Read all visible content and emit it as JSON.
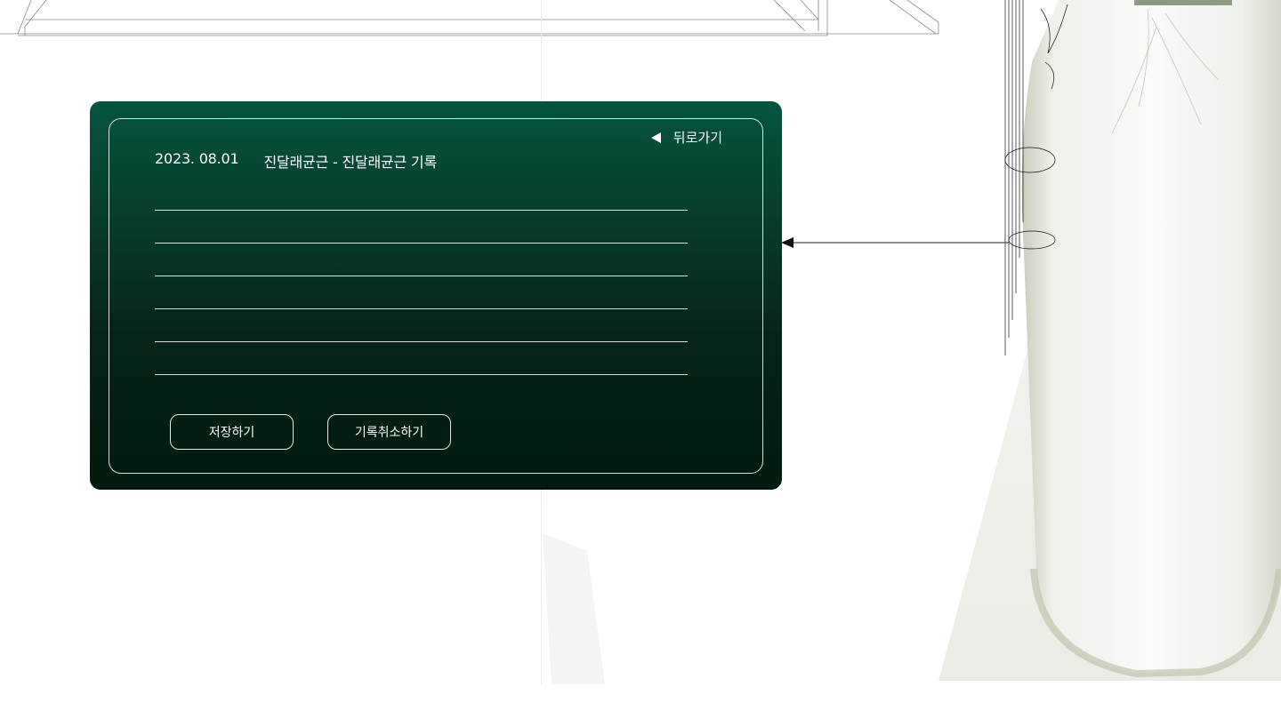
{
  "card": {
    "back_label": "뒤로가기",
    "date": "2023. 08.01",
    "subject": "진달래균근 - 진달래균근 기록",
    "entry_lines": [
      "",
      "",
      "",
      "",
      "",
      ""
    ],
    "buttons": {
      "save_label": "저장하기",
      "cancel_label": "기록취소하기"
    }
  },
  "colors": {
    "card_top": "#055440",
    "card_bottom": "#031b0f",
    "text": "#ffffff"
  },
  "icons": {
    "back": "back-triangle-icon",
    "connector": "arrow-left-icon"
  }
}
